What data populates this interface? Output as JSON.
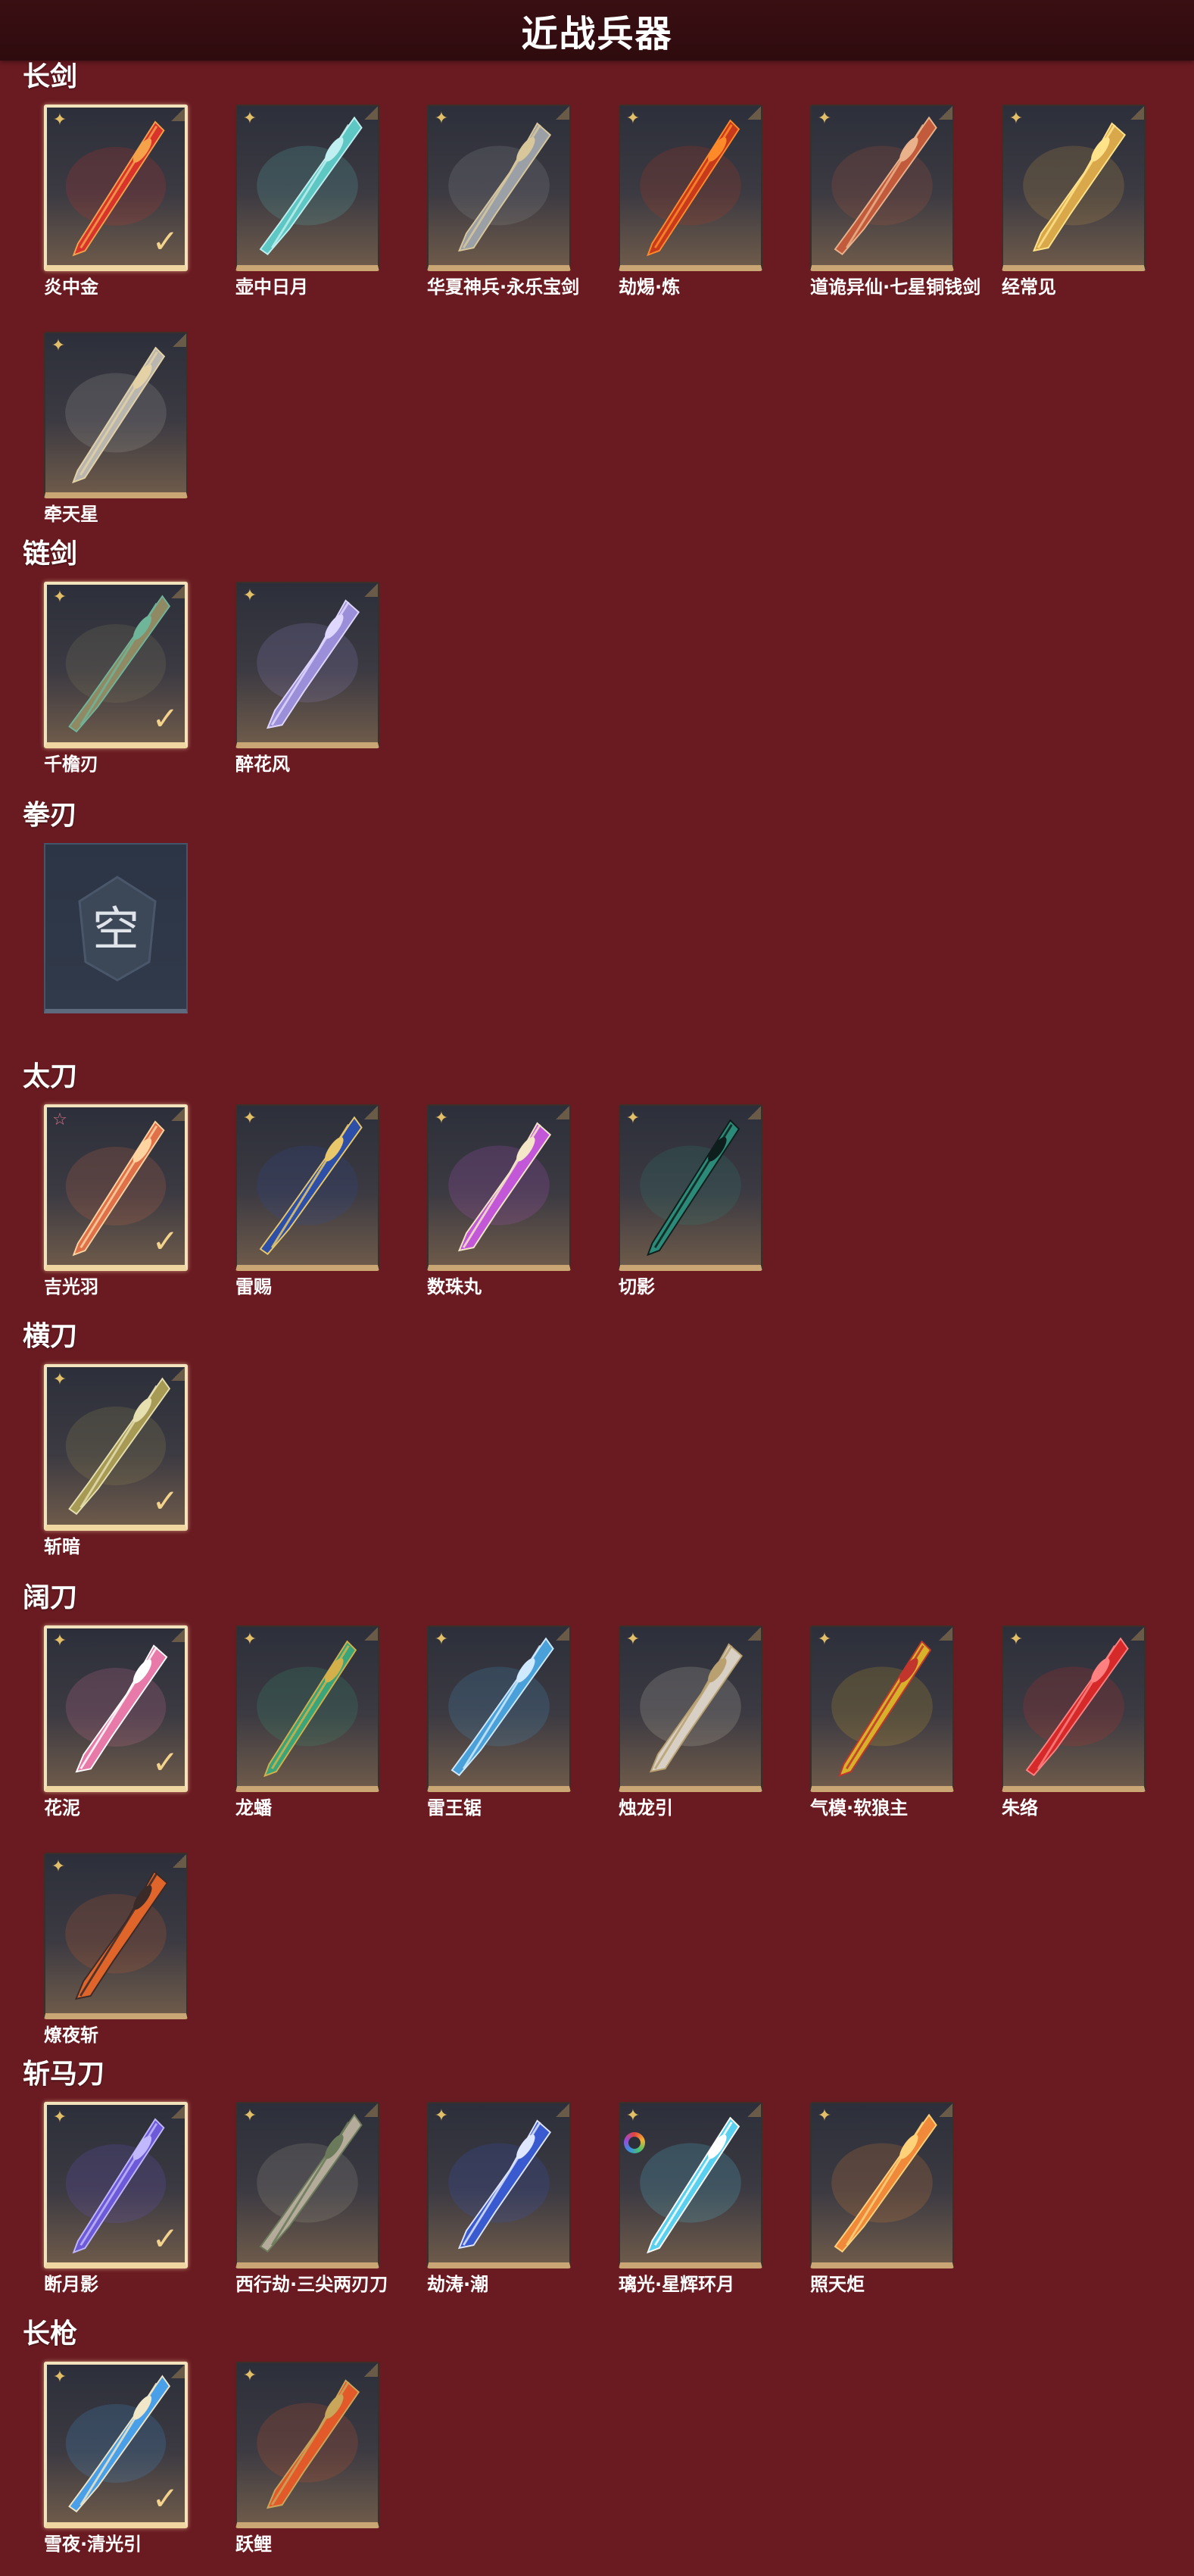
{
  "page": {
    "title": "近战兵器"
  },
  "sections": [
    {
      "name": "长剑",
      "items": [
        {
          "label": "炎中金",
          "selected": true,
          "badge": "gold",
          "color": "#d9342b",
          "accent": "#f5a24a"
        },
        {
          "label": "壶中日月",
          "selected": false,
          "badge": "gold",
          "color": "#5fc7c3",
          "accent": "#bfeff0"
        },
        {
          "label": "华夏神兵·永乐宝剑",
          "selected": false,
          "badge": "gold",
          "color": "#9aa0a6",
          "accent": "#d9c79c"
        },
        {
          "label": "劫焬·炼",
          "selected": false,
          "badge": "gold",
          "color": "#c83a1c",
          "accent": "#ff8a2a"
        },
        {
          "label": "道诡异仙·七星铜钱剑",
          "selected": false,
          "badge": "gold",
          "color": "#c25a3c",
          "accent": "#e9b28a"
        },
        {
          "label": "经常见",
          "selected": false,
          "badge": "gold",
          "color": "#d9a84a",
          "accent": "#ffe38a"
        },
        {
          "label": "牵天星",
          "selected": false,
          "badge": "gold",
          "color": "#b9b6b0",
          "accent": "#e4d2a6"
        }
      ]
    },
    {
      "name": "链剑",
      "items": [
        {
          "label": "千檐刃",
          "selected": true,
          "badge": "gold",
          "color": "#8f8a63",
          "accent": "#6fb59a"
        },
        {
          "label": "醉花风",
          "selected": false,
          "badge": "gold",
          "color": "#9c8fd9",
          "accent": "#e0d7ff"
        }
      ]
    },
    {
      "name": "拳刃",
      "items": [
        {
          "label": "",
          "empty": true,
          "empty_text": "空"
        }
      ]
    },
    {
      "name": "太刀",
      "items": [
        {
          "label": "吉光羽",
          "selected": true,
          "badge": "pink",
          "color": "#e0704a",
          "accent": "#ffd4a0"
        },
        {
          "label": "雷赐",
          "selected": false,
          "badge": "gold",
          "color": "#2e4fa8",
          "accent": "#e8c86a"
        },
        {
          "label": "数珠丸",
          "selected": false,
          "badge": "gold",
          "color": "#c257d8",
          "accent": "#f4e7c8"
        },
        {
          "label": "切影",
          "selected": false,
          "badge": "gold",
          "color": "#2c8a78",
          "accent": "#0e1e1c"
        }
      ]
    },
    {
      "name": "横刀",
      "items": [
        {
          "label": "斩暗",
          "selected": true,
          "badge": "gold",
          "color": "#a69a55",
          "accent": "#e6dfb0"
        }
      ]
    },
    {
      "name": "阔刀",
      "items": [
        {
          "label": "花泥",
          "selected": true,
          "badge": "gold",
          "color": "#e77aa8",
          "accent": "#ffffff"
        },
        {
          "label": "龙蟠",
          "selected": false,
          "badge": "gold",
          "color": "#3aa57a",
          "accent": "#d4b04a"
        },
        {
          "label": "雷王锯",
          "selected": false,
          "badge": "gold",
          "color": "#4aa0d8",
          "accent": "#cfeaff"
        },
        {
          "label": "烛龙引",
          "selected": false,
          "badge": "gold",
          "color": "#d8d0c4",
          "accent": "#b9a070"
        },
        {
          "label": "气模·软狼主",
          "selected": false,
          "badge": "gold",
          "color": "#d7b12a",
          "accent": "#c1352c"
        },
        {
          "label": "朱络",
          "selected": false,
          "badge": "gold",
          "color": "#d62a2a",
          "accent": "#ff8080"
        },
        {
          "label": "燎夜斩",
          "selected": false,
          "badge": "gold",
          "color": "#e0652a",
          "accent": "#3a2a28"
        }
      ]
    },
    {
      "name": "斩马刀",
      "items": [
        {
          "label": "断月影",
          "selected": true,
          "badge": "gold",
          "color": "#6d5ad8",
          "accent": "#c2b8ff"
        },
        {
          "label": "西行劫·三尖两刃刀",
          "selected": false,
          "badge": "gold",
          "color": "#b4ab9a",
          "accent": "#6a7a5a"
        },
        {
          "label": "劫涛·潮",
          "selected": false,
          "badge": "gold",
          "color": "#3a5ad0",
          "accent": "#dfe6ff"
        },
        {
          "label": "璃光·星辉环月",
          "selected": false,
          "badge": "gold",
          "color": "#5ad0f0",
          "accent": "#ffffff",
          "ring": true
        },
        {
          "label": "照天炬",
          "selected": false,
          "badge": "gold",
          "color": "#f08a3a",
          "accent": "#ffd27a"
        }
      ]
    },
    {
      "name": "长枪",
      "items": [
        {
          "label": "雪夜·清光引",
          "selected": true,
          "badge": "gold",
          "color": "#4aa0e8",
          "accent": "#f0e6c8"
        },
        {
          "label": "跃鲤",
          "selected": false,
          "badge": "gold",
          "color": "#e25a2a",
          "accent": "#c9a65a"
        }
      ]
    }
  ]
}
